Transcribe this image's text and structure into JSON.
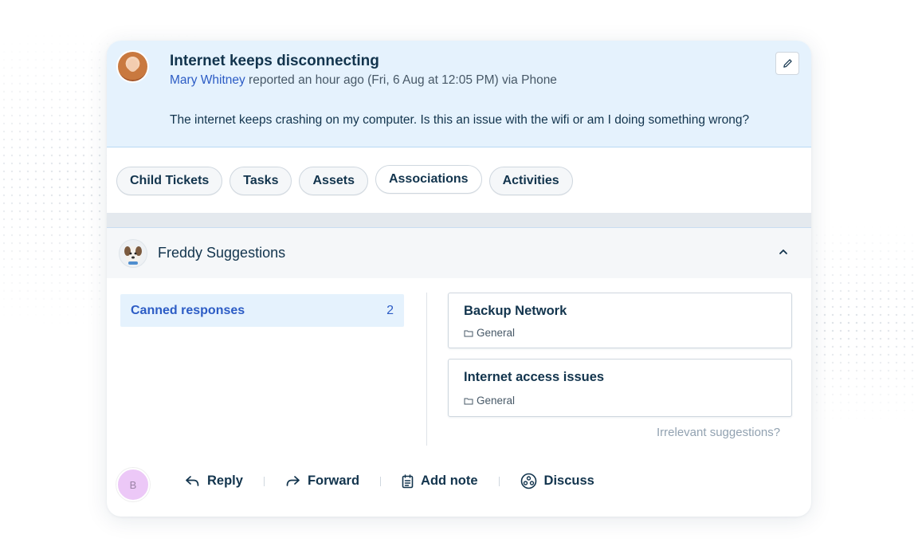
{
  "ticket": {
    "title": "Internet keeps disconnecting",
    "requester": "Mary Whitney",
    "meta": " reported an hour ago (Fri, 6 Aug at 12:05 PM) via Phone",
    "body": "The internet keeps crashing on my computer. Is this an issue with the wifi or am I doing something wrong?"
  },
  "tabs": [
    {
      "label": "Child Tickets"
    },
    {
      "label": "Tasks"
    },
    {
      "label": "Assets"
    },
    {
      "label": "Associations"
    },
    {
      "label": "Activities"
    }
  ],
  "freddy": {
    "title": "Freddy Suggestions",
    "canned_label": "Canned responses",
    "canned_count": "2",
    "suggestions": [
      {
        "title": "Backup Network",
        "folder": "General"
      },
      {
        "title": "Internet access issues",
        "folder": "General"
      }
    ],
    "irrelevant": "Irrelevant suggestions?"
  },
  "actions": {
    "agent_initial": "B",
    "reply": "Reply",
    "forward": "Forward",
    "add_note": "Add note",
    "discuss": "Discuss"
  },
  "colors": {
    "header_bg": "#e5f2fd",
    "link_blue": "#2c5cc5",
    "text_dark": "#12344d",
    "agent_avatar": "#ecc8f7"
  },
  "icons": [
    "pencil-icon",
    "chevron-up-icon",
    "folder-icon",
    "reply-icon",
    "forward-icon",
    "note-icon",
    "discuss-icon"
  ]
}
